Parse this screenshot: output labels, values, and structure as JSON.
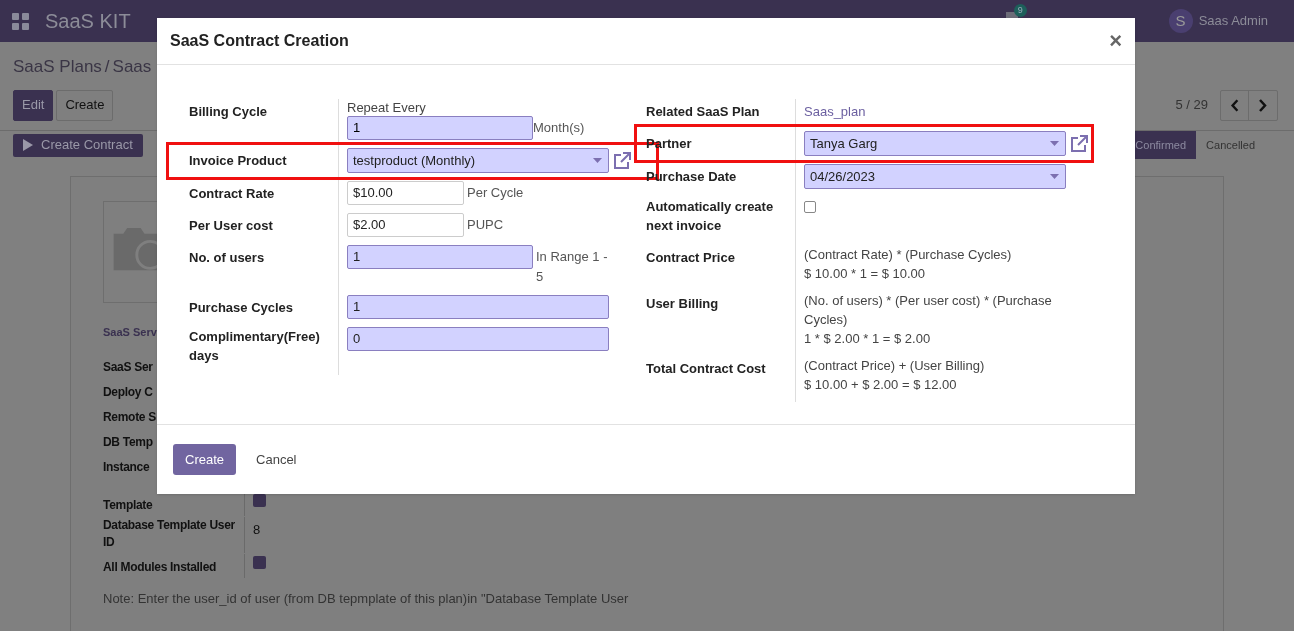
{
  "navbar": {
    "app_name": "SaaS KIT",
    "messages_badge": "9",
    "user_initial": "S",
    "user_name": "Saas Admin"
  },
  "breadcrumb": {
    "items": [
      "SaaS Plans",
      "Saas"
    ],
    "separator": "/"
  },
  "control_buttons": [
    {
      "label": "Edit",
      "primary": true
    },
    {
      "label": "Create",
      "primary": false
    }
  ],
  "pager": "5 / 29",
  "action_button": "Create Contract",
  "stages": [
    {
      "label": "Confirmed",
      "selected": true
    },
    {
      "label": "Cancelled",
      "selected": false
    }
  ],
  "form": {
    "section_title": "SaaS Serv",
    "fields": [
      {
        "label": "SaaS Ser",
        "kind": "text"
      },
      {
        "label": "Deploy C",
        "kind": "text"
      },
      {
        "label": "Remote S",
        "kind": "text"
      },
      {
        "label": "DB Temp",
        "kind": "text"
      },
      {
        "label": "Instance",
        "kind": "text"
      },
      {
        "label": "Template",
        "kind": "checkbox",
        "checked": true
      },
      {
        "label": "Database Template User ID",
        "kind": "text",
        "value": "8"
      },
      {
        "label": "All Modules Installed",
        "kind": "checkbox",
        "checked": true
      }
    ],
    "note": "Note: Enter the user_id of user (from DB tepmplate of this plan)in \"Database Template User"
  },
  "dialog": {
    "title": "SaaS Contract Creation",
    "close": "×",
    "left_fields": [
      {
        "label": "Billing Cycle",
        "kind": "repeat",
        "prefix": "Repeat Every",
        "value": "1",
        "required": true,
        "suffix": "Month(s)",
        "highlighted": false
      },
      {
        "label": "Invoice Product",
        "kind": "select",
        "value": "testproduct (Monthly)",
        "required": true,
        "external_link": true,
        "highlighted": true
      },
      {
        "label": "Contract Rate",
        "kind": "input",
        "value": "$10.00",
        "required": false,
        "suffix": "Per Cycle",
        "highlighted": false
      },
      {
        "label": "Per User cost",
        "kind": "input",
        "value": "$2.00",
        "required": false,
        "suffix": "PUPC",
        "highlighted": false
      },
      {
        "label": "No. of users",
        "kind": "input",
        "value": "1",
        "required": true,
        "suffix": "In Range 1 - 5",
        "highlighted": false
      },
      {
        "label": "Purchase Cycles",
        "kind": "input",
        "value": "1",
        "required": true,
        "highlighted": false
      },
      {
        "label": "Complimentary(Free) days",
        "kind": "input",
        "value": "0",
        "required": true,
        "highlighted": false
      }
    ],
    "right_fields": [
      {
        "label": "Related SaaS Plan",
        "kind": "link",
        "value": "Saas_plan",
        "highlighted": false
      },
      {
        "label": "Partner",
        "kind": "select",
        "value": "Tanya Garg",
        "required": true,
        "external_link": true,
        "highlighted": true
      },
      {
        "label": "Purchase Date",
        "kind": "select",
        "value": "04/26/2023",
        "required": true,
        "external_link": false,
        "highlighted": false
      },
      {
        "label": "Automatically create next invoice",
        "kind": "checkbox",
        "checked": false,
        "highlighted": false
      },
      {
        "label": "Contract Price",
        "kind": "lines",
        "lines": [
          "(Contract Rate) * (Purchase Cycles)",
          "$ 10.00 * 1 = $ 10.00"
        ],
        "highlighted": false
      },
      {
        "label": "User Billing",
        "kind": "lines",
        "lines": [
          "(No. of users) * (Per user cost) * (Purchase Cycles)",
          "1 * $ 2.00 * 1 = $ 2.00"
        ],
        "highlighted": false
      },
      {
        "label": "Total Contract Cost",
        "kind": "lines",
        "lines": [
          "(Contract Price) + (User Billing)",
          "$ 10.00 + $ 2.00 = $ 12.00"
        ],
        "highlighted": false
      }
    ],
    "buttons": [
      {
        "label": "Create",
        "primary": true
      },
      {
        "label": "Cancel",
        "primary": false
      }
    ]
  }
}
